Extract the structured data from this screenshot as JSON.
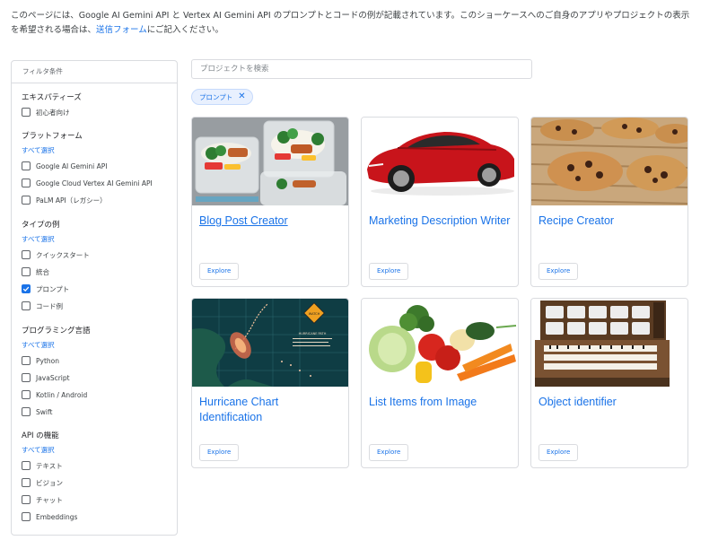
{
  "intro": {
    "text": "このページには、Google AI Gemini API と Vertex AI Gemini API のプロンプトとコードの例が記載されています。このショーケースへのご自身のアプリやプロジェクトの表示を希望される場合は、",
    "link": "送信フォーム",
    "suffix": "にご記入ください。"
  },
  "sidebar": {
    "header": "フィルタ条件",
    "groups": [
      {
        "title": "エキスパティーズ",
        "select_all": "",
        "options": [
          {
            "label": "初心者向け",
            "checked": false
          }
        ]
      },
      {
        "title": "プラットフォーム",
        "select_all": "すべて選択",
        "options": [
          {
            "label": "Google AI Gemini API",
            "checked": false
          },
          {
            "label": "Google Cloud Vertex AI Gemini API",
            "checked": false
          },
          {
            "label": "PaLM API（レガシー）",
            "checked": false
          }
        ]
      },
      {
        "title": "タイプの例",
        "select_all": "すべて選択",
        "options": [
          {
            "label": "クイックスタート",
            "checked": false
          },
          {
            "label": "統合",
            "checked": false
          },
          {
            "label": "プロンプト",
            "checked": true
          },
          {
            "label": "コード例",
            "checked": false
          }
        ]
      },
      {
        "title": "プログラミング言語",
        "select_all": "すべて選択",
        "options": [
          {
            "label": "Python",
            "checked": false
          },
          {
            "label": "JavaScript",
            "checked": false
          },
          {
            "label": "Kotlin / Android",
            "checked": false
          },
          {
            "label": "Swift",
            "checked": false
          }
        ]
      },
      {
        "title": "API の機能",
        "select_all": "すべて選択",
        "options": [
          {
            "label": "テキスト",
            "checked": false
          },
          {
            "label": "ビジョン",
            "checked": false
          },
          {
            "label": "チャット",
            "checked": false
          },
          {
            "label": "Embeddings",
            "checked": false
          }
        ]
      }
    ]
  },
  "search": {
    "placeholder": "プロジェクトを検索"
  },
  "chip": {
    "label": "プロンプト",
    "icon": "close-icon"
  },
  "cards": [
    {
      "title": "Blog Post Creator",
      "button": "Explore",
      "image": "meal-prep-containers-image"
    },
    {
      "title": "Marketing Description Writer",
      "button": "Explore",
      "image": "red-sports-car-image"
    },
    {
      "title": "Recipe Creator",
      "button": "Explore",
      "image": "chocolate-chip-cookies-image"
    },
    {
      "title": "Hurricane Chart Identification",
      "button": "Explore",
      "image": "hurricane-tracking-chart-image",
      "image_text": {
        "sign": "WATCH",
        "caption": "HURRICANE PATH"
      }
    },
    {
      "title": "List Items from Image",
      "button": "Explore",
      "image": "vegetables-image"
    },
    {
      "title": "Object identifier",
      "button": "Explore",
      "image": "pipe-organ-console-image"
    }
  ],
  "colors": {
    "link": "#1a73e8",
    "border": "#dadce0",
    "chip_bg": "#e8f0fe"
  }
}
